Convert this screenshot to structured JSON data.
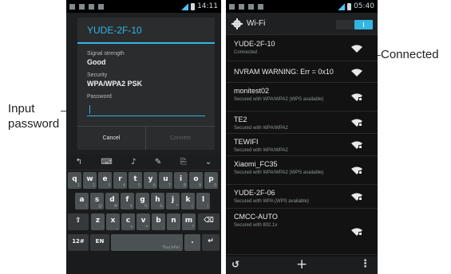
{
  "callouts": {
    "input_password_line1": "Input",
    "input_password_line2": "password",
    "connected": "Connected"
  },
  "left_screen": {
    "status_time": "14:11",
    "dialog": {
      "title": "YUDE-2F-10",
      "signal_label": "Signal strength",
      "signal_value": "Good",
      "security_label": "Security",
      "security_value": "WPA/WPA2 PSK",
      "password_label": "Password",
      "password_value": "",
      "cancel_label": "Cancel",
      "connect_label": "Connect"
    },
    "keyboard": {
      "row1": [
        {
          "k": "q",
          "a": "1"
        },
        {
          "k": "w",
          "a": "2"
        },
        {
          "k": "e",
          "a": "3"
        },
        {
          "k": "r",
          "a": "4"
        },
        {
          "k": "t",
          "a": "5"
        },
        {
          "k": "y",
          "a": "6"
        },
        {
          "k": "u",
          "a": "7"
        },
        {
          "k": "i",
          "a": "8"
        },
        {
          "k": "o",
          "a": "9"
        },
        {
          "k": "p",
          "a": "0"
        }
      ],
      "row2": [
        {
          "k": "a",
          "a": "!"
        },
        {
          "k": "s",
          "a": "@"
        },
        {
          "k": "d",
          "a": "#"
        },
        {
          "k": "f",
          "a": "$"
        },
        {
          "k": "g",
          "a": "%"
        },
        {
          "k": "h",
          "a": "&"
        },
        {
          "k": "j",
          "a": "*"
        },
        {
          "k": "k",
          "a": "("
        },
        {
          "k": "l",
          "a": ")"
        }
      ],
      "row3": [
        {
          "k": "z",
          "a": "-"
        },
        {
          "k": "x",
          "a": "_"
        },
        {
          "k": "c",
          "a": "+"
        },
        {
          "k": "v",
          "a": "="
        },
        {
          "k": "b",
          "a": ";"
        },
        {
          "k": "n",
          "a": ":"
        },
        {
          "k": "m",
          "a": "?"
        }
      ],
      "mode_key": "12#",
      "lang_key": "EN",
      "space_label": "TouchPal",
      "period_key": "."
    }
  },
  "right_screen": {
    "status_time": "05:40",
    "title": "Wi-Fi",
    "wifi_enabled": true,
    "networks": [
      {
        "name": "YUDE-2F-10",
        "sub": "Connected"
      },
      {
        "name": "NVRAM WARNING: Err = 0x10",
        "sub": ""
      },
      {
        "name": "monitest02",
        "sub": "Secured with WPA/WPA2 (WPS available)"
      },
      {
        "name": "TE2",
        "sub": "Secured with WPA/WPA2"
      },
      {
        "name": "TEWIFI",
        "sub": "Secured with WPA/WPA2"
      },
      {
        "name": "Xiaomi_FC35",
        "sub": "Secured with WPA/WPA2 (WPS available)"
      },
      {
        "name": "YUDE-2F-06",
        "sub": "Secured with WPA (WPS available)"
      },
      {
        "name": "CMCC-AUTO",
        "sub": "Secured with 802.1x"
      }
    ]
  },
  "colors": {
    "accent": "#33b5e5",
    "key": "#4c5154",
    "background": "#121212"
  }
}
